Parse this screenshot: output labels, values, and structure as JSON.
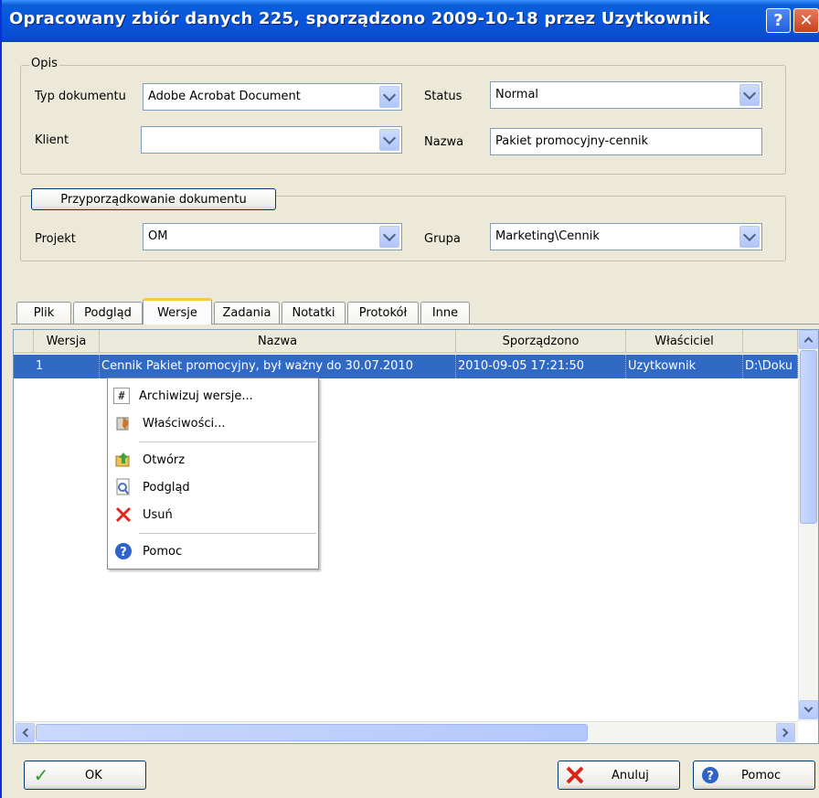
{
  "window": {
    "title": "Opracowany zbiór danych 225, sporządzono 2009-10-18 przez Uzytkownik",
    "help_label": "?",
    "close_label": "✕"
  },
  "opis": {
    "legend": "Opis",
    "typ_label": "Typ dokumentu",
    "typ_value": "Adobe Acrobat Document",
    "status_label": "Status",
    "status_value": "Normal",
    "klient_label": "Klient",
    "klient_value": "",
    "nazwa_label": "Nazwa",
    "nazwa_value": "Pakiet promocyjny-cennik"
  },
  "assign": {
    "button_label": "Przyporządkowanie dokumentu",
    "projekt_label": "Projekt",
    "projekt_value": "OM",
    "grupa_label": "Grupa",
    "grupa_value": "Marketing\\Cennik"
  },
  "tabs": [
    "Plik",
    "Podgląd",
    "Wersje",
    "Zadania",
    "Notatki",
    "Protokół",
    "Inne"
  ],
  "active_tab": "Wersje",
  "grid": {
    "headers": [
      "Wersja",
      "Nazwa",
      "Sporządzono",
      "Właściciel",
      ""
    ],
    "rows": [
      {
        "wersja": "1",
        "nazwa": "Cennik Pakiet promocyjny, był ważny do 30.07.2010",
        "sporzadzono": "2010-09-05 17:21:50",
        "wlasciciel": "Uzytkownik",
        "sciezka": "D:\\Doku"
      }
    ]
  },
  "context_menu": {
    "items": [
      {
        "label": "Archiwizuj wersje...",
        "icon": "hash-icon"
      },
      {
        "label": "Właściwości...",
        "icon": "properties-icon"
      },
      {
        "label": "Otwórz",
        "icon": "open-icon"
      },
      {
        "label": "Podgląd",
        "icon": "preview-icon"
      },
      {
        "label": "Usuń",
        "icon": "delete-icon"
      },
      {
        "label": "Pomoc",
        "icon": "help-icon"
      }
    ]
  },
  "buttons": {
    "ok": "OK",
    "cancel": "Anuluj",
    "help": "Pomoc"
  }
}
